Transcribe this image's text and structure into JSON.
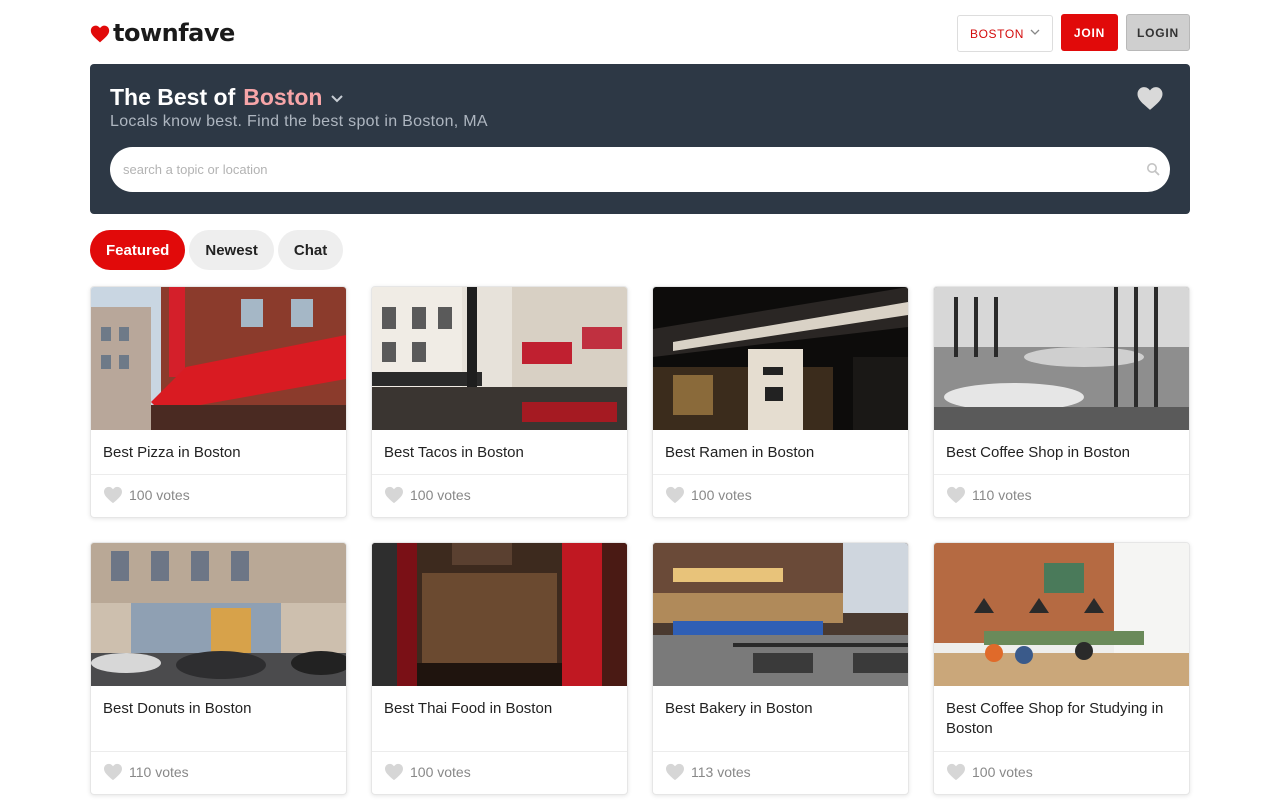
{
  "header": {
    "logo_text": "townfave",
    "city_select": "BOSTON",
    "join_label": "JOIN",
    "login_label": "LOGIN"
  },
  "hero": {
    "title_prefix": "The Best of",
    "city": "Boston",
    "subtitle": "Locals know best. Find the best spot in Boston, MA",
    "search_placeholder": "search a topic or location"
  },
  "tabs": [
    {
      "label": "Featured",
      "active": true
    },
    {
      "label": "Newest",
      "active": false
    },
    {
      "label": "Chat",
      "active": false
    }
  ],
  "cards": [
    {
      "title": "Best Pizza in Boston",
      "votes": "100 votes",
      "image": "pizza-storefront-photo"
    },
    {
      "title": "Best Tacos in Boston",
      "votes": "100 votes",
      "image": "chinatown-street-photo"
    },
    {
      "title": "Best Ramen in Boston",
      "votes": "100 votes",
      "image": "ramen-restaurant-night-photo"
    },
    {
      "title": "Best Coffee Shop in Boston",
      "votes": "110 votes",
      "image": "cafe-chairs-bw-photo"
    },
    {
      "title": "Best Donuts in Boston",
      "votes": "110 votes",
      "image": "donut-shop-corner-photo"
    },
    {
      "title": "Best Thai Food in Boston",
      "votes": "100 votes",
      "image": "thai-restaurant-window-photo"
    },
    {
      "title": "Best Bakery in Boston",
      "votes": "113 votes",
      "image": "pastry-shop-street-photo"
    },
    {
      "title": "Best Coffee Shop for Studying in Boston",
      "votes": "100 votes",
      "image": "study-cafe-interior-photo"
    }
  ],
  "colors": {
    "brand_red": "#e10a0a",
    "hero_bg": "#2d3845",
    "hero_city": "#f7a5a8"
  }
}
